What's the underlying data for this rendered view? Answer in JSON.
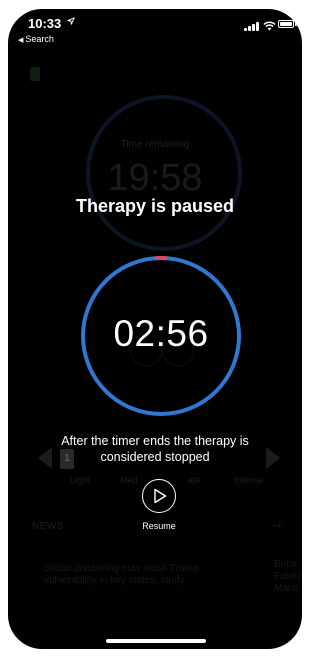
{
  "status_bar": {
    "time": "10:33",
    "location_icon": "location-arrow-icon",
    "back_label": "Search"
  },
  "background": {
    "time_remaining_label": "Time remaining",
    "time_remaining_value": "19:58",
    "level_number": "1",
    "levels": [
      "Light",
      "Med",
      "ate",
      "Intense"
    ],
    "news_label": "NEWS",
    "headline": "Social distancing may mask Trump vulnerability in key states, study",
    "headline_side": "Befor Fabric Mans"
  },
  "overlay": {
    "title": "Therapy is paused",
    "timer": "02:56",
    "info": "After the timer ends the therapy is considered stopped",
    "resume_label": "Resume"
  },
  "colors": {
    "ring": "#2f77d0",
    "ring_accent": "#d64b6a",
    "background": "#000000"
  }
}
